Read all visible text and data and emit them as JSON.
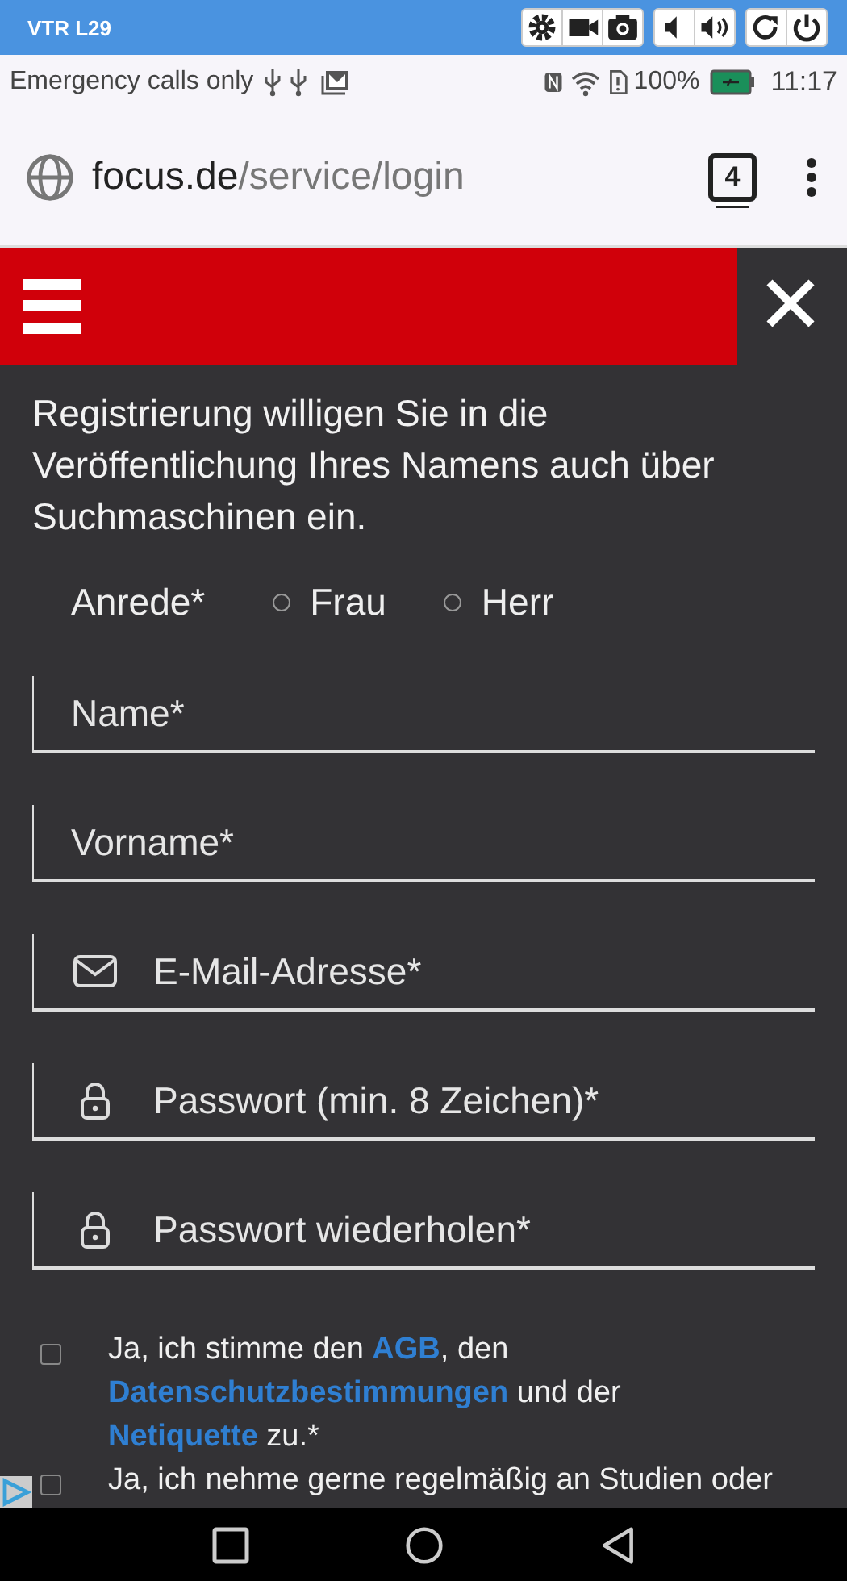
{
  "device_bar": {
    "title": "VTR L29"
  },
  "status_bar": {
    "carrier": "Emergency calls only",
    "battery": "100%",
    "time": "11:17"
  },
  "address_bar": {
    "host": "focus.de",
    "path": "/service/login",
    "tab_count": "4"
  },
  "intro": "Registrierung willigen Sie in die Veröffentlichung Ihres Namens auch über Suchmaschinen ein.",
  "salutation": {
    "label": "Anrede*",
    "options": [
      {
        "label": "Frau",
        "selected": false
      },
      {
        "label": "Herr",
        "selected": false
      }
    ]
  },
  "fields": [
    {
      "placeholder": "Name*",
      "kind": "plain"
    },
    {
      "placeholder": "Vorname*",
      "kind": "plain"
    },
    {
      "placeholder": "E-Mail-Adresse*",
      "kind": "email"
    },
    {
      "placeholder": "Passwort (min. 8 Zeichen)*",
      "kind": "password"
    },
    {
      "placeholder": "Passwort wiederholen*",
      "kind": "password"
    }
  ],
  "consents": [
    {
      "checked": false,
      "parts": [
        {
          "kind": "text",
          "text": "Ja, ich stimme den "
        },
        {
          "kind": "link",
          "text": "AGB"
        },
        {
          "kind": "text",
          "text": ", den "
        },
        {
          "kind": "link",
          "text": "Datenschutzbestimmungen"
        },
        {
          "kind": "text",
          "text": " und der "
        },
        {
          "kind": "link",
          "text": "Netiquette"
        },
        {
          "kind": "text",
          "text": " zu.*"
        }
      ]
    },
    {
      "checked": false,
      "parts": [
        {
          "kind": "text",
          "text": "Ja, ich nehme gerne regelmäßig an Studien oder"
        }
      ]
    }
  ]
}
